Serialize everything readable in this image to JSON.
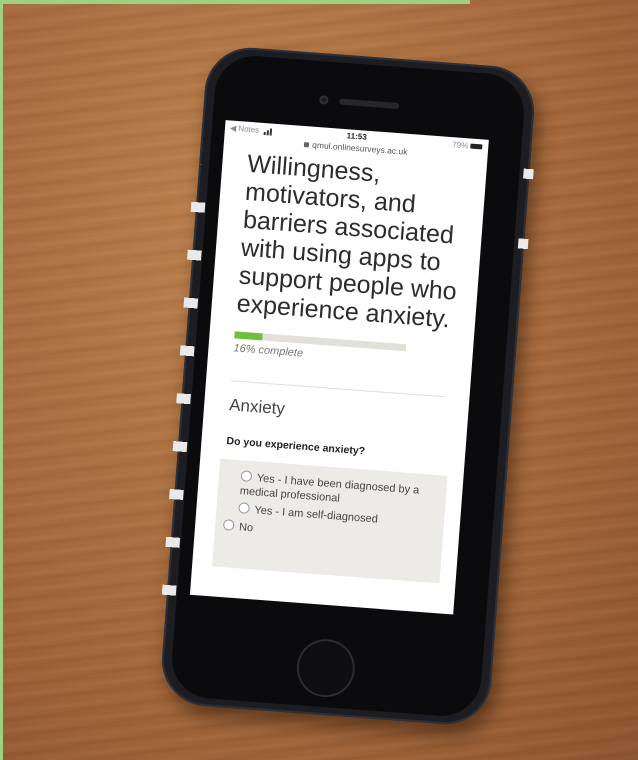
{
  "status_bar": {
    "back_app": "◀ Notes",
    "time": "11:53",
    "battery": "79%",
    "url": "qmul.onlinesurveys.ac.uk"
  },
  "survey": {
    "title": "Willingness, motivators, and barriers associated with using apps to support people who experience anxiety.",
    "progress_percent": 16,
    "progress_label": "16% complete",
    "section_title": "Anxiety",
    "question": "Do you experience anxiety?",
    "options": [
      "Yes - I have been diagnosed by a medical professional",
      "Yes - I am self-diagnosed",
      "No"
    ]
  },
  "colors": {
    "progress_fill": "#6fbf3a",
    "progress_track": "#e3e0d9",
    "options_bg": "#ecebe6",
    "phone_case": "#1c1d22"
  }
}
